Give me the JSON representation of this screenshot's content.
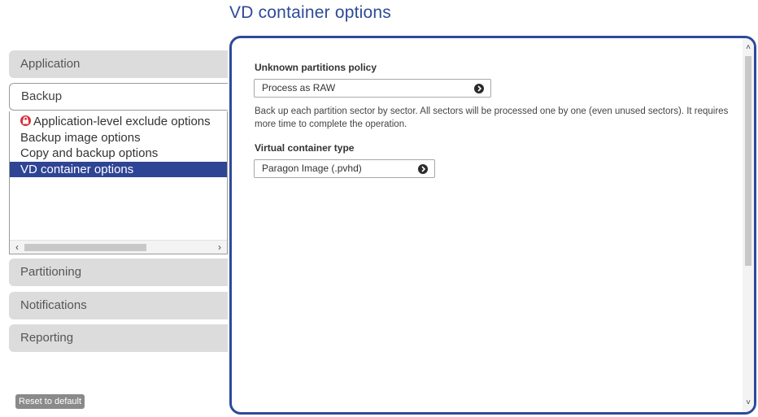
{
  "page": {
    "title": "VD container options"
  },
  "sidebar": {
    "tabs": {
      "application": "Application",
      "backup": "Backup",
      "partitioning": "Partitioning",
      "notifications": "Notifications",
      "reporting": "Reporting"
    },
    "backup_items": [
      {
        "label": "Application-level exclude options",
        "locked": true
      },
      {
        "label": "Backup image options"
      },
      {
        "label": "Copy and backup options"
      },
      {
        "label": "VD container options",
        "selected": true
      }
    ],
    "reset_label": "Reset to default"
  },
  "main": {
    "unknown_partitions": {
      "label": "Unknown partitions policy",
      "value": "Process as RAW",
      "description": "Back up each partition sector by sector. All sectors will be processed one by one (even unused sectors). It requires more time to complete the operation."
    },
    "container_type": {
      "label": "Virtual container type",
      "value": "Paragon Image (.pvhd)"
    }
  },
  "colors": {
    "accent": "#2d4a9a",
    "selected_bg": "#2e4494",
    "tab_bg": "#dcdcdc",
    "lock": "#d8303a"
  },
  "icons": {
    "lock": "lock-icon",
    "dropdown": "chevron-circle-right-icon",
    "scroll_left": "scroll-left-arrow-icon",
    "scroll_right": "scroll-right-arrow-icon",
    "scroll_up": "scroll-up-arrow-icon",
    "scroll_down": "scroll-down-arrow-icon"
  }
}
